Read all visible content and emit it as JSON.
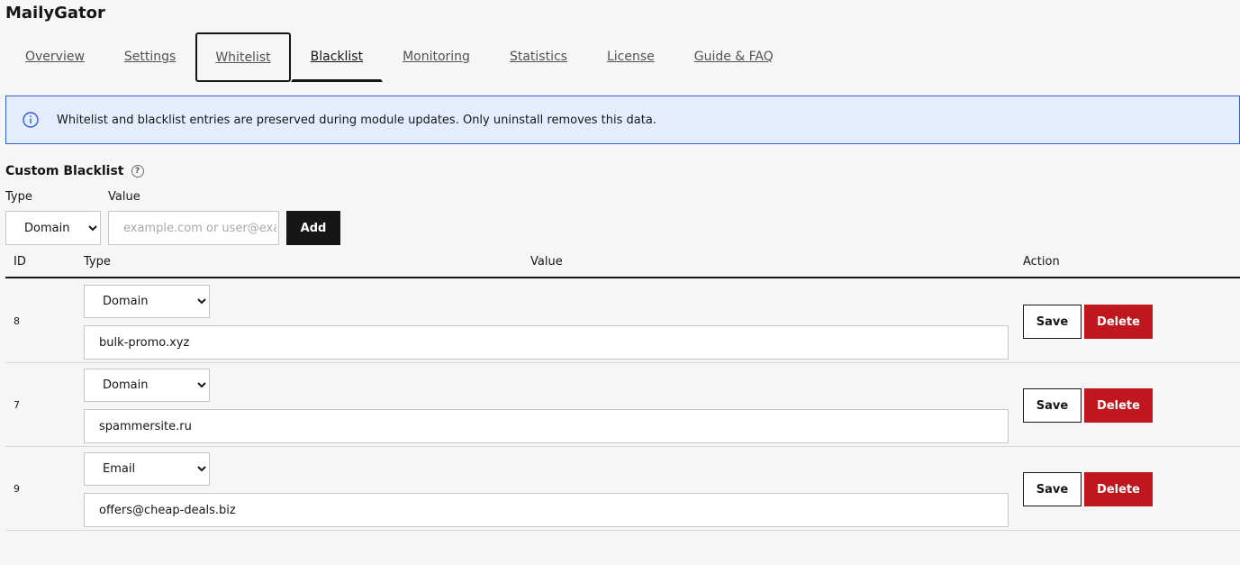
{
  "app": {
    "title": "MailyGator"
  },
  "tabs": [
    {
      "label": "Overview"
    },
    {
      "label": "Settings"
    },
    {
      "label": "Whitelist"
    },
    {
      "label": "Blacklist"
    },
    {
      "label": "Monitoring"
    },
    {
      "label": "Statistics"
    },
    {
      "label": "License"
    },
    {
      "label": "Guide & FAQ"
    }
  ],
  "active_tab": "Blacklist",
  "focused_tab": "Whitelist",
  "notice": {
    "icon": "info-icon",
    "text": "Whitelist and blacklist entries are preserved during module updates. Only uninstall removes this data."
  },
  "section": {
    "title": "Custom Blacklist",
    "help_icon": "?"
  },
  "add_form": {
    "type_label": "Type",
    "value_label": "Value",
    "type_value": "Domain",
    "value_placeholder": "example.com or user@example.com",
    "add_label": "Add"
  },
  "type_options": [
    "Domain",
    "Email"
  ],
  "table": {
    "columns": [
      "ID",
      "Type",
      "Value",
      "Action"
    ],
    "rows": [
      {
        "id": "8",
        "type": "Domain",
        "value": "bulk-promo.xyz"
      },
      {
        "id": "7",
        "type": "Domain",
        "value": "spammersite.ru"
      },
      {
        "id": "9",
        "type": "Email",
        "value": "offers@cheap-deals.biz"
      }
    ],
    "save_label": "Save",
    "delete_label": "Delete"
  },
  "colors": {
    "notice_background": "#e5ecfb",
    "notice_border": "#2d5fdb",
    "delete_button": "#c0161d",
    "primary_button": "#161616"
  }
}
